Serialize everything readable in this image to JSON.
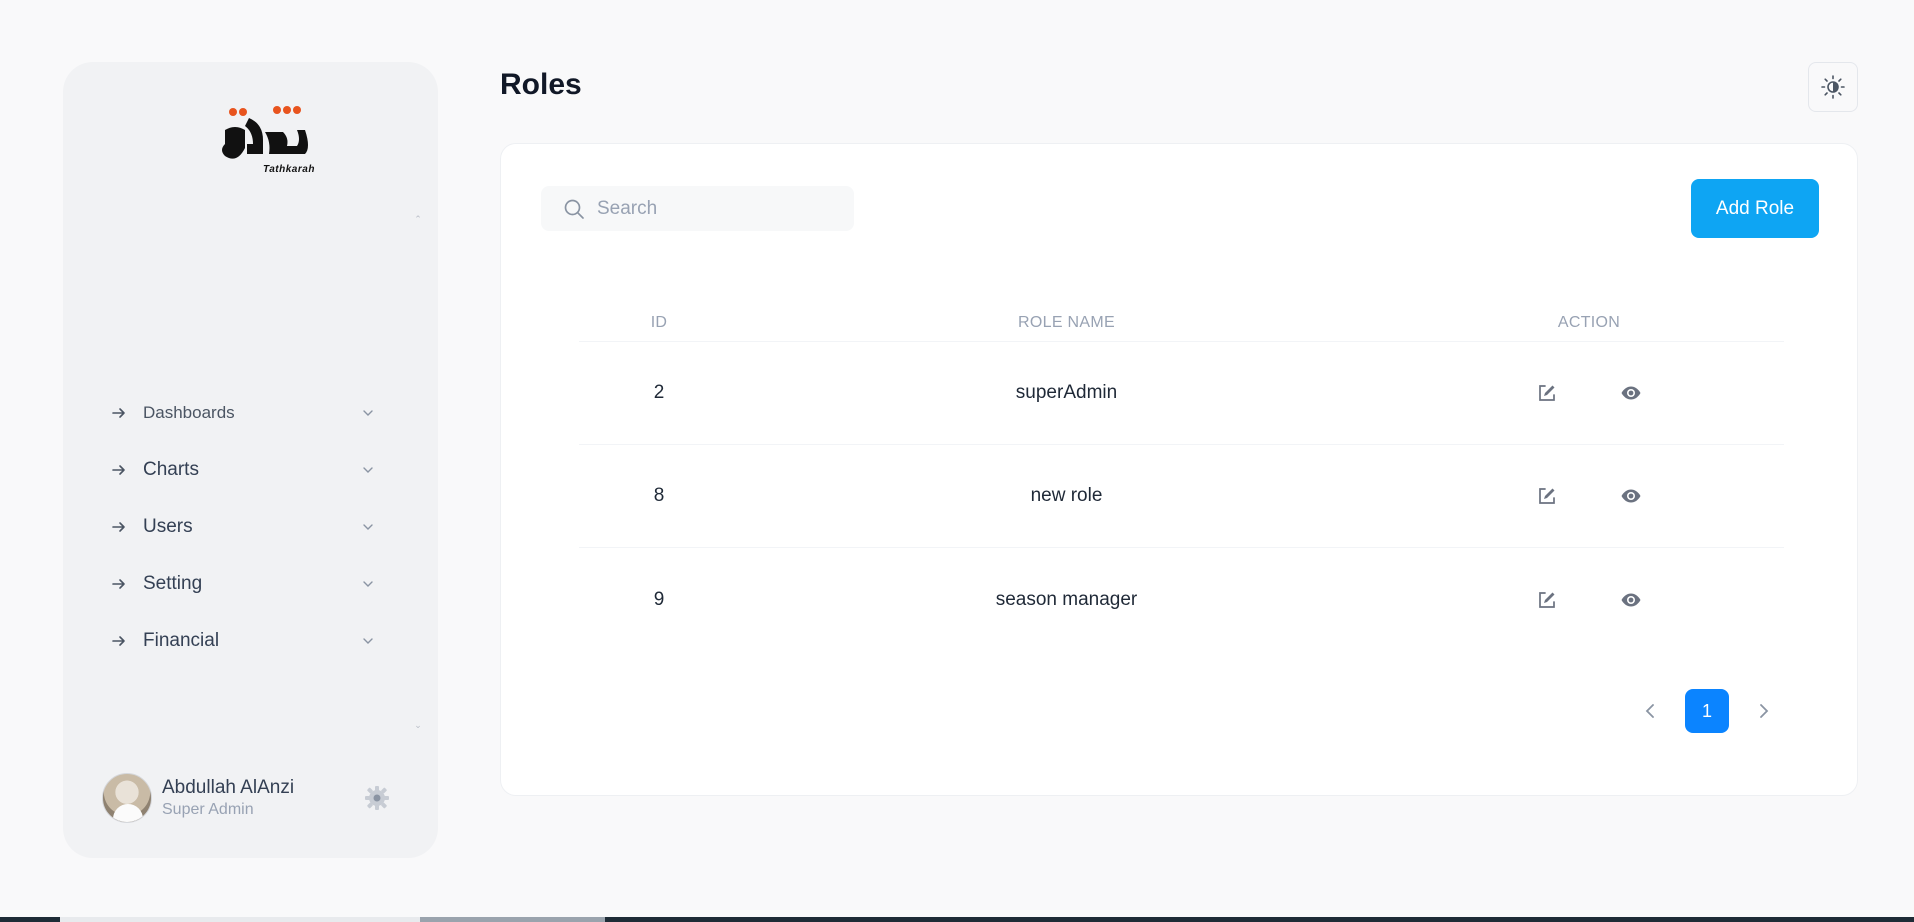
{
  "sidebar": {
    "logo_caption": "Tathkarah",
    "items": [
      {
        "label": "Dashboards"
      },
      {
        "label": "Charts"
      },
      {
        "label": "Users"
      },
      {
        "label": "Setting"
      },
      {
        "label": "Financial"
      }
    ],
    "profile": {
      "name": "Abdullah AlAnzi",
      "role": "Super Admin"
    }
  },
  "header": {
    "title": "Roles"
  },
  "toolbar": {
    "search_placeholder": "Search",
    "add_label": "Add Role"
  },
  "table": {
    "columns": [
      "ID",
      "ROLE NAME",
      "ACTION"
    ],
    "rows": [
      {
        "id": "2",
        "name": "superAdmin"
      },
      {
        "id": "8",
        "name": "new role"
      },
      {
        "id": "9",
        "name": "season manager"
      }
    ]
  },
  "pagination": {
    "current_page": "1"
  },
  "icons": {
    "nav": "arrow-right-icon",
    "expand": "chevron-down-icon",
    "edit": "edit-icon",
    "view": "eye-icon",
    "theme": "sun-icon",
    "settings": "gear-icon",
    "search": "search-icon"
  },
  "colors": {
    "primary": "#0ea5f3",
    "page_active": "#0b84ff",
    "logo_dots": "#e8541e"
  }
}
